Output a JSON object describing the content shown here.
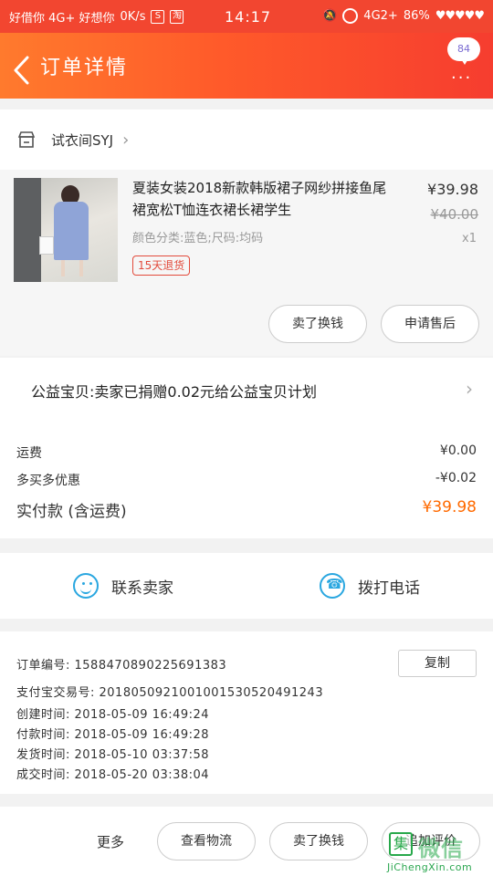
{
  "status_bar": {
    "carrier": "好借你 4G+ 好想你",
    "speed": "0K/s",
    "app_icon_1": "S",
    "app_icon_2": "淘",
    "time": "14:17",
    "network": "4G2+",
    "battery": "86%",
    "hearts": "♥♥♥♥♥"
  },
  "nav": {
    "title": "订单详情",
    "message_count": "84"
  },
  "shop": {
    "name": "试衣间SYJ"
  },
  "item": {
    "title": "夏装女装2018新款韩版裙子网纱拼接鱼尾裙宽松T恤连衣裙长裙学生",
    "spec": "颜色分类:蓝色;尺码:均码",
    "return_badge": "15天退货",
    "price": "¥39.98",
    "original_price": "¥40.00",
    "quantity": "x1",
    "btn_refund": "卖了换钱",
    "btn_after_sale": "申请售后"
  },
  "charity": {
    "text": "公益宝贝:卖家已捐赠0.02元给公益宝贝计划"
  },
  "fees": {
    "shipping_label": "运费",
    "shipping_value": "¥0.00",
    "discount_label": "多买多优惠",
    "discount_value": "-¥0.02",
    "total_label": "实付款 (含运费)",
    "total_value": "¥39.98"
  },
  "contact": {
    "seller_label": "联系卖家",
    "call_label": "拨打电话"
  },
  "order_info": {
    "order_no": "订单编号: 1588470890225691383",
    "copy_label": "复制",
    "alipay_no": "支付宝交易号: 2018050921001001530520491243",
    "created": "创建时间: 2018-05-09 16:49:24",
    "paid": "付款时间: 2018-05-09 16:49:28",
    "shipped": "发货时间: 2018-05-10 03:37:58",
    "completed": "成交时间: 2018-05-20 03:38:04"
  },
  "bottom": {
    "more_label": "更多",
    "btn_logistics": "查看物流",
    "btn_sell": "卖了换钱",
    "btn_review": "追加评价"
  },
  "watermark": {
    "box": "集",
    "cn": "微信",
    "en": "JiChengXin.com"
  },
  "colors": {
    "nav_start": "#ff7a2d",
    "nav_end": "#f63d2f",
    "accent_orange": "#ff6a00",
    "contact_blue": "#2aa7e0",
    "badge_red": "#e24a3b"
  }
}
